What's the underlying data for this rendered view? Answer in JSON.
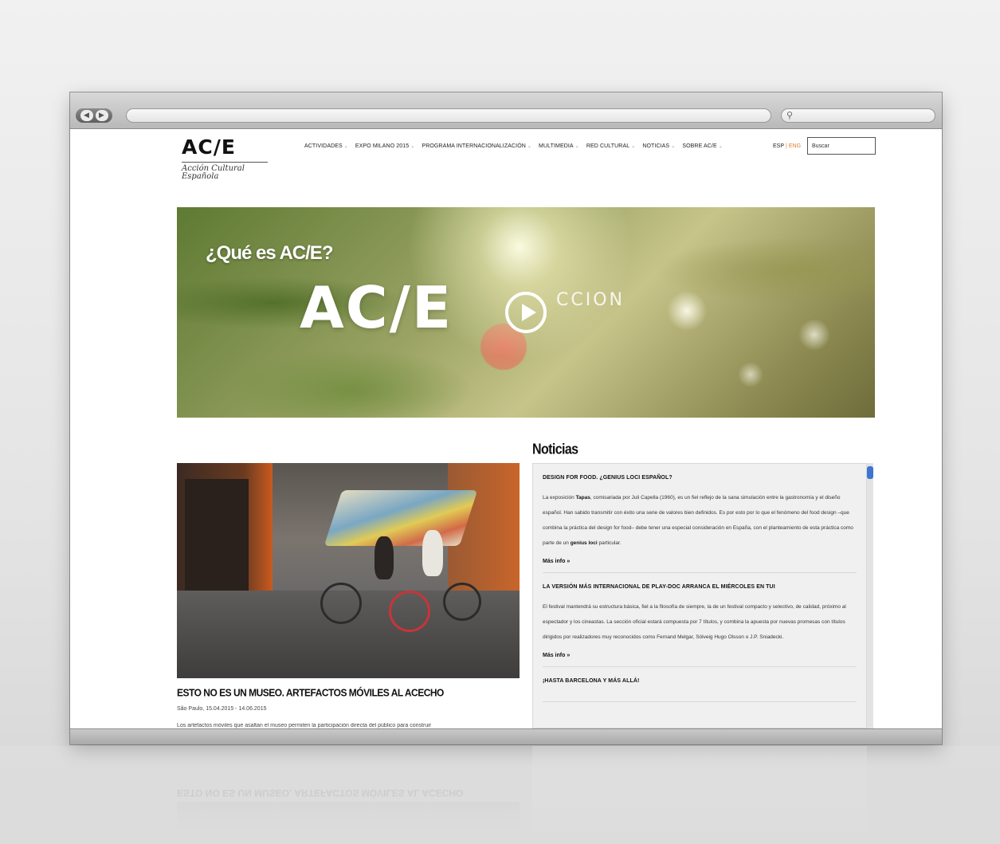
{
  "browser": {
    "back_icon": "back-arrow-icon",
    "forward_icon": "forward-arrow-icon",
    "search_icon": "magnifier-icon",
    "url": ""
  },
  "site": {
    "logo": "AC/E",
    "logo_sub_line1": "Acción Cultural",
    "logo_sub_line2": "Española",
    "nav": [
      {
        "label": "Actividades",
        "caret": "⌄"
      },
      {
        "label": "Expo Milano 2015",
        "caret": "⌄"
      },
      {
        "label": "Programa Internacionalización",
        "caret": "⌄"
      },
      {
        "label": "Multimedia",
        "caret": "⌄"
      },
      {
        "label": "Red Cultural",
        "caret": "⌄"
      },
      {
        "label": "Noticias",
        "caret": "⌄"
      },
      {
        "label": "Sobre AC/E",
        "caret": "⌄"
      }
    ],
    "lang_esp": "ESP",
    "lang_sep": "|",
    "lang_eng": "ENG",
    "search_value": "Buscar"
  },
  "hero": {
    "question": "¿Qué es AC/E?",
    "big": "AC/E",
    "word": "CCION"
  },
  "article": {
    "title": "ESTO NO ES UN MUSEO. ARTEFACTOS MÓVILES AL ACECHO",
    "meta": "São Paulo, 15.04.2015 - 14.06.2015",
    "snippet": "Los artefactos móviles que asaltan el museo permiten la participación directa del público para construir"
  },
  "news": {
    "heading": "Noticias",
    "items": [
      {
        "title": "DESIGN FOR FOOD. ¿GENIUS LOCI ESPAÑOL?",
        "body_pre": "La exposición ",
        "body_bold1": "Tapas",
        "body_mid": ", comisariada por Juli Capella (1960), es un fiel reflejo de la sana simulación entre la gastronomía y el diseño español. Han sabido transmitir con éxito una serie de valores bien definidos. Es por esto por lo que el fenómeno del food design –que combina la práctica del design for food– debe tener una especial consideración en España, con el planteamiento de esta práctica como parte de un ",
        "body_bold2": "genius loci",
        "body_post": " particular.",
        "more": "Más info »"
      },
      {
        "title": "LA VERSIÓN MÁS INTERNACIONAL DE PLAY-DOC ARRANCA EL MIÉRCOLES EN TUI",
        "body": "El festival mantendrá su estructura básica, fiel a la filosofía de siempre, la de un festival compacto y selectivo, de calidad, próximo al espectador y los cineastas. La sección oficial estará compuesta por 7 títulos, y combina la apuesta por nuevas promesas con títulos dirigidos por realizadores muy reconocidos como Fernand Melgar, Sólveig Hugo Olsson o J.P. Sniadecki.",
        "more": "Más info »"
      },
      {
        "title": "¡HASTA BARCELONA Y MÁS ALLÁ!"
      }
    ]
  },
  "colors": {
    "accent": "#e07a2a",
    "scroll_thumb": "#3c76cf"
  }
}
